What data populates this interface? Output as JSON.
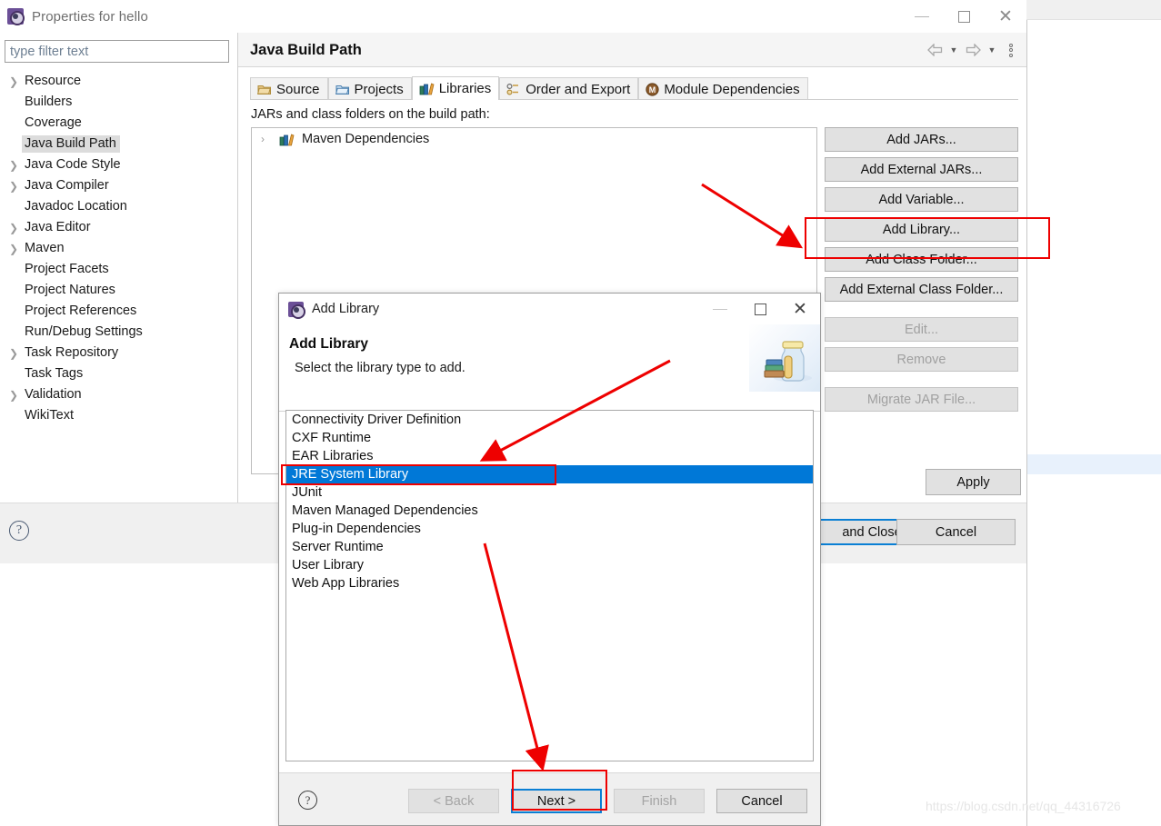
{
  "window": {
    "title": "Properties for hello",
    "icon": "gear-icon",
    "controls": {
      "minimize": "minimize",
      "maximize": "maximize",
      "close": "close"
    }
  },
  "sidebar": {
    "filter": {
      "value": "",
      "placeholder": "type filter text"
    },
    "items": [
      {
        "label": "Resource",
        "expandable": true,
        "selected": false
      },
      {
        "label": "Builders",
        "expandable": false,
        "selected": false
      },
      {
        "label": "Coverage",
        "expandable": false,
        "selected": false
      },
      {
        "label": "Java Build Path",
        "expandable": false,
        "selected": true
      },
      {
        "label": "Java Code Style",
        "expandable": true,
        "selected": false
      },
      {
        "label": "Java Compiler",
        "expandable": true,
        "selected": false
      },
      {
        "label": "Javadoc Location",
        "expandable": false,
        "selected": false
      },
      {
        "label": "Java Editor",
        "expandable": true,
        "selected": false
      },
      {
        "label": "Maven",
        "expandable": true,
        "selected": false
      },
      {
        "label": "Project Facets",
        "expandable": false,
        "selected": false
      },
      {
        "label": "Project Natures",
        "expandable": false,
        "selected": false
      },
      {
        "label": "Project References",
        "expandable": false,
        "selected": false
      },
      {
        "label": "Run/Debug Settings",
        "expandable": false,
        "selected": false
      },
      {
        "label": "Task Repository",
        "expandable": true,
        "selected": false
      },
      {
        "label": "Task Tags",
        "expandable": false,
        "selected": false
      },
      {
        "label": "Validation",
        "expandable": true,
        "selected": false
      },
      {
        "label": "WikiText",
        "expandable": false,
        "selected": false
      }
    ],
    "help_icon": "?"
  },
  "page": {
    "title": "Java Build Path",
    "nav": {
      "back_icon": "back-arrow-icon",
      "back_caret": "▼",
      "forward_icon": "forward-arrow-icon",
      "forward_caret": "▼",
      "menu_icon": "vertical-dots-icon"
    },
    "tabs": [
      {
        "label": "Source",
        "icon": "source-folder-icon",
        "active": false
      },
      {
        "label": "Projects",
        "icon": "projects-folder-icon",
        "active": false
      },
      {
        "label": "Libraries",
        "icon": "libraries-books-icon",
        "active": true
      },
      {
        "label": "Order and Export",
        "icon": "order-export-icon",
        "active": false
      },
      {
        "label": "Module Dependencies",
        "icon": "module-m-icon",
        "active": false
      }
    ],
    "list_label": "JARs and class folders on the build path:",
    "entries": [
      {
        "label": "Maven Dependencies",
        "icon": "libraries-books-icon",
        "expandable": true
      }
    ],
    "buttons": [
      {
        "label": "Add JARs...",
        "enabled": true,
        "gap": false
      },
      {
        "label": "Add External JARs...",
        "enabled": true,
        "gap": false
      },
      {
        "label": "Add Variable...",
        "enabled": true,
        "gap": false
      },
      {
        "label": "Add Library...",
        "enabled": true,
        "gap": false
      },
      {
        "label": "Add Class Folder...",
        "enabled": true,
        "gap": false
      },
      {
        "label": "Add External Class Folder...",
        "enabled": true,
        "gap": false
      },
      {
        "label": "Edit...",
        "enabled": false,
        "gap": true
      },
      {
        "label": "Remove",
        "enabled": false,
        "gap": false
      },
      {
        "label": "Migrate JAR File...",
        "enabled": false,
        "gap": true
      }
    ],
    "apply_label": "Apply",
    "apply_and_close_label": "Apply and Close",
    "apply_and_close_visible_text": "and Close",
    "cancel_label": "Cancel"
  },
  "dialog": {
    "titlebar": {
      "title": "Add Library",
      "icon": "gear-icon"
    },
    "heading": "Add Library",
    "subheading": "Select the library type to add.",
    "banner_icon": "jar-with-books-icon",
    "library_types": [
      {
        "label": "Connectivity Driver Definition",
        "selected": false
      },
      {
        "label": "CXF Runtime",
        "selected": false
      },
      {
        "label": "EAR Libraries",
        "selected": false
      },
      {
        "label": "JRE System Library",
        "selected": true
      },
      {
        "label": "JUnit",
        "selected": false
      },
      {
        "label": "Maven Managed Dependencies",
        "selected": false
      },
      {
        "label": "Plug-in Dependencies",
        "selected": false
      },
      {
        "label": "Server Runtime",
        "selected": false
      },
      {
        "label": "User Library",
        "selected": false
      },
      {
        "label": "Web App Libraries",
        "selected": false
      }
    ],
    "help_icon": "?",
    "buttons": {
      "back": {
        "label": "< Back",
        "enabled": false,
        "focused": false
      },
      "next": {
        "label": "Next >",
        "enabled": true,
        "focused": true
      },
      "finish": {
        "label": "Finish",
        "enabled": false,
        "focused": false
      },
      "cancel": {
        "label": "Cancel",
        "enabled": true,
        "focused": false
      }
    }
  },
  "annotations": {
    "color": "#ee0000",
    "boxes": [
      "add-library-button",
      "jre-system-library-row",
      "next-button"
    ],
    "arrows": [
      "arrow-to-add-library",
      "arrow-to-jre-system-library",
      "arrow-to-next-button"
    ]
  },
  "watermark": {
    "text": "https://blog.csdn.net/qq_44316726"
  }
}
